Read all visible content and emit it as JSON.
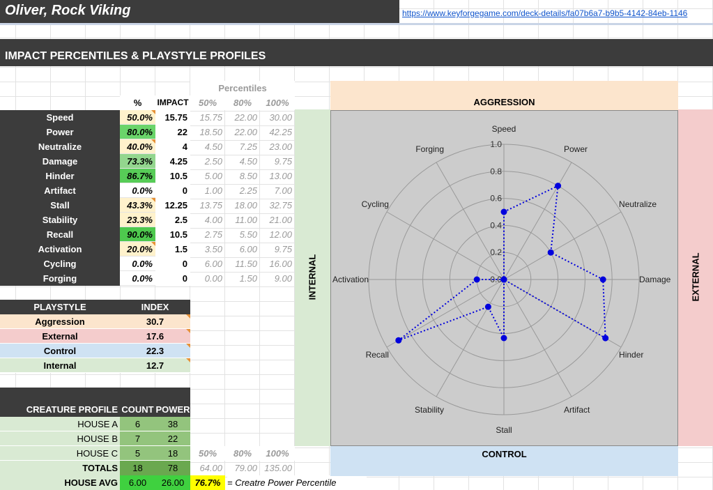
{
  "header": {
    "title": "Oliver, Rock Viking",
    "deck_link": "https://www.keyforgegame.com/deck-details/fa07b6a7-b9b5-4142-84eb-1146"
  },
  "section_title": "IMPACT PERCENTILES & PLAYSTYLE PROFILES",
  "stats_table": {
    "percentiles_header": "Percentiles",
    "col_pct": "%",
    "col_impact": "IMPACT",
    "col_p50": "50%",
    "col_p80": "80%",
    "col_p100": "100%",
    "rows": [
      {
        "label": "Speed",
        "pct": "50.0%",
        "impact": "15.75",
        "p50": "15.75",
        "p80": "22.00",
        "p100": "30.00",
        "color": "#fff2cc"
      },
      {
        "label": "Power",
        "pct": "80.0%",
        "impact": "22",
        "p50": "18.50",
        "p80": "22.00",
        "p100": "42.25",
        "color": "#6ad46a"
      },
      {
        "label": "Neutralize",
        "pct": "40.0%",
        "impact": "4",
        "p50": "4.50",
        "p80": "7.25",
        "p100": "23.00",
        "color": "#fff2cc"
      },
      {
        "label": "Damage",
        "pct": "73.3%",
        "impact": "4.25",
        "p50": "2.50",
        "p80": "4.50",
        "p100": "9.75",
        "color": "#93d68e"
      },
      {
        "label": "Hinder",
        "pct": "86.7%",
        "impact": "10.5",
        "p50": "5.00",
        "p80": "8.50",
        "p100": "13.00",
        "color": "#57cc57"
      },
      {
        "label": "Artifact",
        "pct": "0.0%",
        "impact": "0",
        "p50": "1.00",
        "p80": "2.25",
        "p100": "7.00",
        "color": "#ffffff"
      },
      {
        "label": "Stall",
        "pct": "43.3%",
        "impact": "12.25",
        "p50": "13.75",
        "p80": "18.00",
        "p100": "32.75",
        "color": "#fff2cc"
      },
      {
        "label": "Stability",
        "pct": "23.3%",
        "impact": "2.5",
        "p50": "4.00",
        "p80": "11.00",
        "p100": "21.00",
        "color": "#fff2cc"
      },
      {
        "label": "Recall",
        "pct": "90.0%",
        "impact": "10.5",
        "p50": "2.75",
        "p80": "5.50",
        "p100": "12.00",
        "color": "#4ec94e"
      },
      {
        "label": "Activation",
        "pct": "20.0%",
        "impact": "1.5",
        "p50": "3.50",
        "p80": "6.00",
        "p100": "9.75",
        "color": "#fff2cc"
      },
      {
        "label": "Cycling",
        "pct": "0.0%",
        "impact": "0",
        "p50": "6.00",
        "p80": "11.50",
        "p100": "16.00",
        "color": "#ffffff"
      },
      {
        "label": "Forging",
        "pct": "0.0%",
        "impact": "0",
        "p50": "0.00",
        "p80": "1.50",
        "p100": "9.00",
        "color": "#ffffff"
      }
    ]
  },
  "playstyle": {
    "col_label": "PLAYSTYLE",
    "col_index": "INDEX",
    "rows": [
      {
        "label": "Aggression",
        "value": "30.7",
        "color": "#fce5cd"
      },
      {
        "label": "External",
        "value": "17.6",
        "color": "#f4cccc"
      },
      {
        "label": "Control",
        "value": "22.3",
        "color": "#cfe2f3"
      },
      {
        "label": "Internal",
        "value": "12.7",
        "color": "#d9ead3"
      }
    ]
  },
  "creature_profile": {
    "col_label": "CREATURE PROFILE",
    "col_count": "COUNT",
    "col_power": "POWER",
    "rows": [
      {
        "label": "HOUSE A",
        "count": "6",
        "power": "38"
      },
      {
        "label": "HOUSE B",
        "count": "7",
        "power": "22"
      },
      {
        "label": "HOUSE C",
        "count": "5",
        "power": "18"
      }
    ],
    "p50_header": "50%",
    "p80_header": "80%",
    "p100_header": "100%",
    "totals": {
      "label": "TOTALS",
      "count": "18",
      "power": "78",
      "p50": "64.00",
      "p80": "79.00",
      "p100": "135.00"
    },
    "house_avg": {
      "label": "HOUSE AVG",
      "count": "6.00",
      "power": "26.00",
      "percentile": "76.7%",
      "note": "= Creatre Power Percentile"
    }
  },
  "chart_labels": {
    "aggression": "AGGRESSION",
    "control": "CONTROL",
    "internal": "INTERNAL",
    "external": "EXTERNAL"
  },
  "chart_data": {
    "type": "radar",
    "categories": [
      "Speed",
      "Power",
      "Neutralize",
      "Damage",
      "Hinder",
      "Artifact",
      "Stall",
      "Stability",
      "Recall",
      "Activation",
      "Cycling",
      "Forging"
    ],
    "series": [
      {
        "values": [
          0.5,
          0.8,
          0.4,
          0.733,
          0.867,
          0.0,
          0.433,
          0.233,
          0.9,
          0.2,
          0.0,
          0.0
        ]
      }
    ],
    "rlim": [
      0,
      1.0
    ],
    "rticks": [
      "0.0",
      "0.2",
      "0.4",
      "0.6",
      "0.8",
      "1.0"
    ],
    "series_color": "#0000dd",
    "grid_color": "#999999",
    "background": "#cccccc"
  }
}
